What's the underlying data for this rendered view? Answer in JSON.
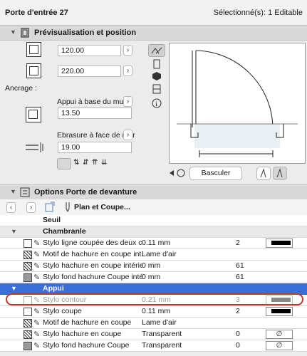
{
  "window": {
    "title": "Porte d'entrée 27",
    "selection": "Sélectionné(s): 1 Editable"
  },
  "preview_section": {
    "title": "Prévisualisation et position"
  },
  "dimensions": {
    "width": "120.00",
    "height": "220.00"
  },
  "anchor": {
    "label": "Ancrage :",
    "base_option": "Appui à base du mur",
    "base_value": "13.50",
    "reveal_option": "Ebrasure à face de mur",
    "reveal_value": "19.00"
  },
  "flip_button": "Basculer",
  "options_section": {
    "title": "Options Porte de devanture",
    "nav_label": "Plan et Coupe..."
  },
  "grid": {
    "seuil_label": "Seuil",
    "chambranle_label": "Chambranle",
    "appui_label": "Appui",
    "chambranle_rows": [
      {
        "name": "Stylo ligne coupée des deux c...",
        "value": "0.11 mm",
        "num": "2"
      },
      {
        "name": "Motif de hachure en coupe int...",
        "value": "Lame d'air",
        "num": ""
      },
      {
        "name": "Stylo hachure en coupe intérieur",
        "value": "0 mm",
        "num": "61"
      },
      {
        "name": "Stylo fond hachure Coupe inté...",
        "value": "0 mm",
        "num": "61"
      }
    ],
    "appui_rows": [
      {
        "name": "Stylo contour",
        "value": "0.21 mm",
        "num": "3"
      },
      {
        "name": "Stylo coupe",
        "value": "0.11 mm",
        "num": "2"
      },
      {
        "name": "Motif de hachure en coupe",
        "value": "Lame d'air",
        "num": ""
      },
      {
        "name": "Stylo hachure en coupe",
        "value": "Transparent",
        "num": "0"
      },
      {
        "name": "Stylo fond hachure Coupe",
        "value": "Transparent",
        "num": "0"
      }
    ]
  },
  "colors": {
    "selected_row": "#3a6fd8",
    "highlight_outline": "#c0392b"
  }
}
